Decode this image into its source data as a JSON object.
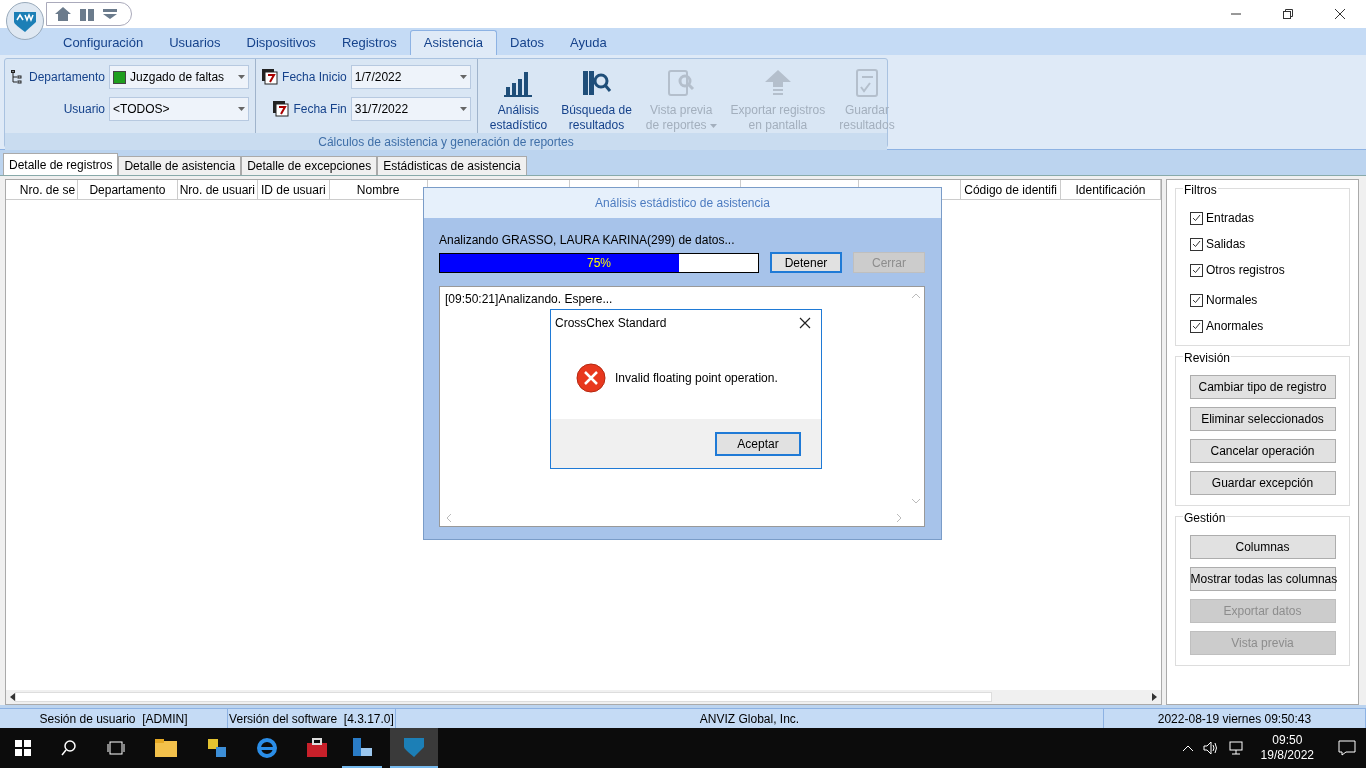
{
  "ribbon_tabs": [
    {
      "label": "Configuración",
      "selected": false
    },
    {
      "label": "Usuarios",
      "selected": false
    },
    {
      "label": "Dispositivos",
      "selected": false
    },
    {
      "label": "Registros",
      "selected": false
    },
    {
      "label": "Asistencia",
      "selected": true
    },
    {
      "label": "Datos",
      "selected": false
    },
    {
      "label": "Ayuda",
      "selected": false
    }
  ],
  "filters": {
    "department_label": "Departamento",
    "department_value": "Juzgado de faltas",
    "user_label": "Usuario",
    "user_value": "<TODOS>",
    "start_label": "Fecha Inicio",
    "start_value": "1/7/2022",
    "end_label": "Fecha Fin",
    "end_value": "31/7/2022"
  },
  "ribbon_buttons": [
    {
      "kind": "chart",
      "line1": "Análisis",
      "line2": "estadístico",
      "disabled": false
    },
    {
      "kind": "search",
      "line1": "Búsqueda de",
      "line2": "resultados",
      "disabled": false
    },
    {
      "kind": "preview",
      "line1": "Vista previa",
      "line2": "de reportes",
      "disabled": true,
      "dropdown": true
    },
    {
      "kind": "export",
      "line1": "Exportar registros",
      "line2": "en pantalla",
      "disabled": true
    },
    {
      "kind": "save",
      "line1": "Guardar",
      "line2": "resultados",
      "disabled": true
    }
  ],
  "ribbon_group": "Cálculos de asistencia y generación de reportes",
  "doc_tabs": [
    {
      "label": "Detalle de registros",
      "selected": true
    },
    {
      "label": "Detalle de asistencia",
      "selected": false
    },
    {
      "label": "Detalle de excepciones",
      "selected": false
    },
    {
      "label": "Estádisticas de asistencia",
      "selected": false
    }
  ],
  "table": {
    "columns": [
      "Nro. de se",
      "Departamento",
      "Nro. de usuari",
      "ID de usuari",
      "Nombre",
      "",
      "",
      "",
      "",
      "",
      "Código de identifi",
      "Identificación"
    ]
  },
  "filtros": {
    "title": "Filtros",
    "items": [
      {
        "label": "Entradas",
        "checked": true
      },
      {
        "label": "Salidas",
        "checked": true
      },
      {
        "label": "Otros registros",
        "checked": true
      },
      {
        "label": "Normales",
        "checked": true
      },
      {
        "label": "Anormales",
        "checked": true
      }
    ]
  },
  "revision": {
    "title": "Revisión",
    "buttons": [
      {
        "label": "Cambiar tipo de registro",
        "disabled": false
      },
      {
        "label": "Eliminar seleccionados",
        "disabled": false
      },
      {
        "label": "Cancelar operación",
        "disabled": false
      },
      {
        "label": "Guardar excepción",
        "disabled": false
      }
    ]
  },
  "gestion": {
    "title": "Gestión",
    "buttons": [
      {
        "label": "Columnas",
        "disabled": false
      },
      {
        "label": "Mostrar todas las columnas",
        "disabled": false
      },
      {
        "label": "Exportar datos",
        "disabled": true
      },
      {
        "label": "Vista previa",
        "disabled": true
      }
    ]
  },
  "status_bar": [
    "Sesión de usuario  [ADMIN]",
    "Versión del software  [4.3.17.0]",
    "ANVIZ Global, Inc.",
    "2022-08-19 viernes 09:50:43"
  ],
  "progress_dialog": {
    "title": "Análisis estádistico de asistencia",
    "status": "Analizando GRASSO, LAURA KARINA(299) de datos...",
    "level": 0.75,
    "reading": "75%",
    "stop": "Detener",
    "close": "Cerrar",
    "close_disabled": true,
    "log": "[09:50:21]Analizando. Espere..."
  },
  "message_box": {
    "title": "CrossChex Standard",
    "message": "Invalid floating point operation.",
    "button": "Aceptar"
  },
  "taskbar": {
    "time": "09:50",
    "date": "19/8/2022"
  }
}
